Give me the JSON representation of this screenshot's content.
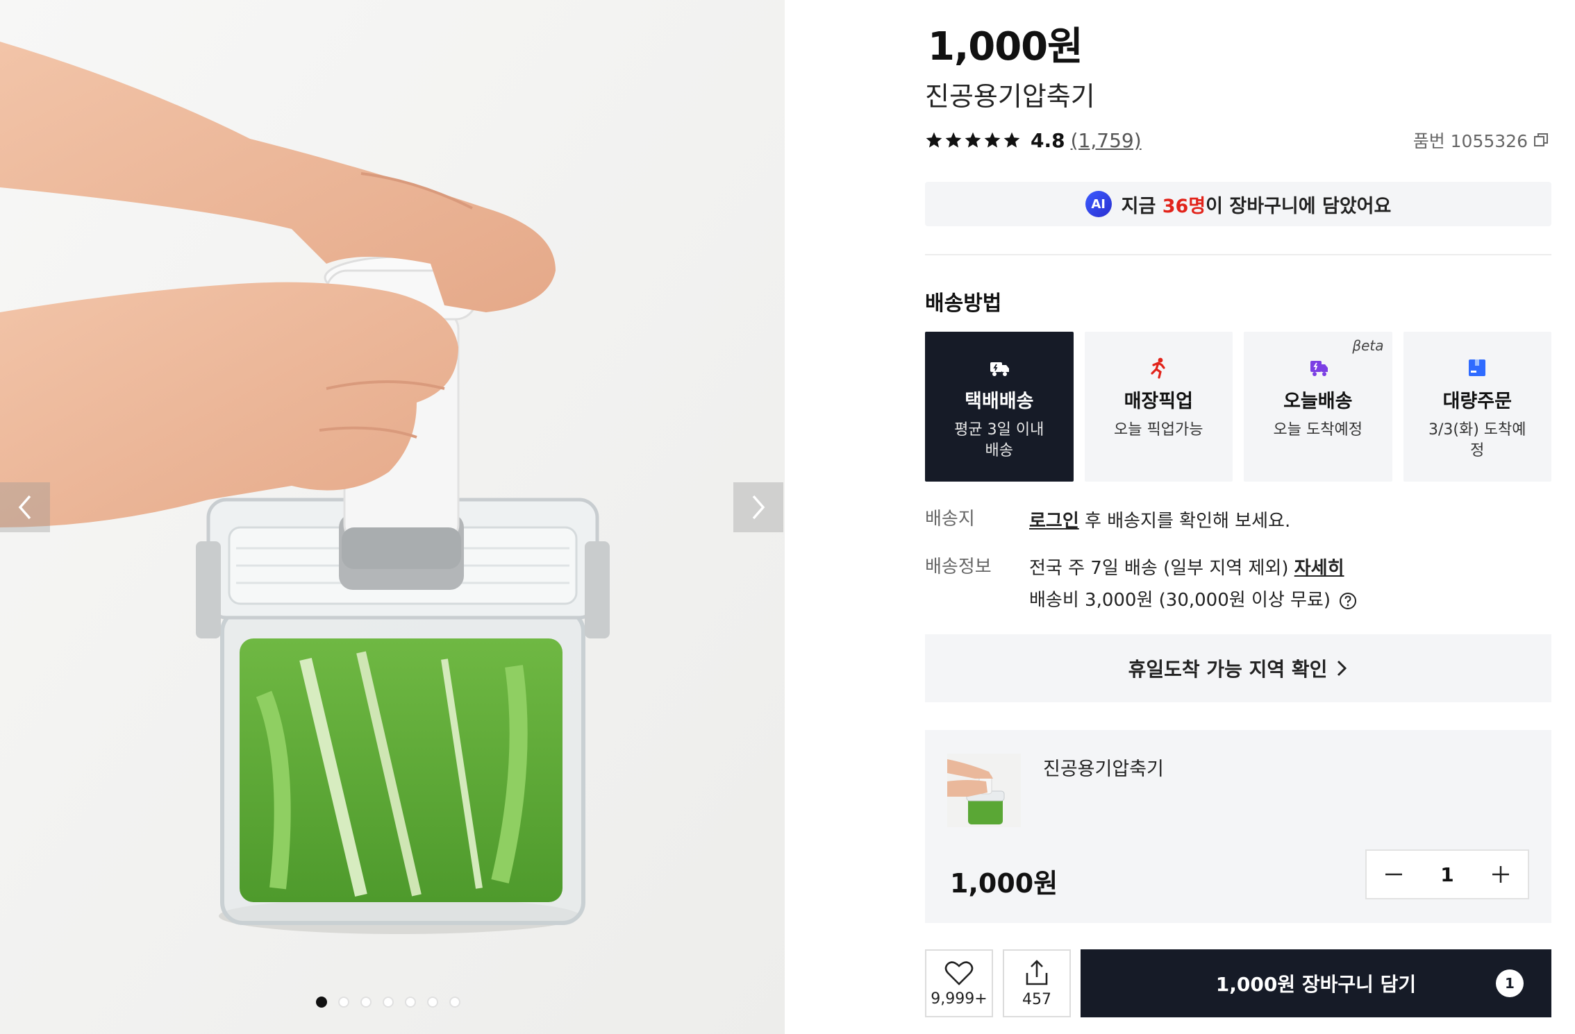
{
  "gallery": {
    "image_alt": "진공용기압축기",
    "dot_count": 7,
    "active_dot": 0
  },
  "product": {
    "price": "1,000원",
    "title": "진공용기압축기",
    "rating_value": "4.8",
    "rating_count": "(1,759)",
    "stars": 5,
    "sku": "품번 1055326"
  },
  "ai_banner": {
    "badge": "AI",
    "prefix": "지금 ",
    "highlight": "36명",
    "suffix": "이 장바구니에 담았어요"
  },
  "delivery": {
    "section_title": "배송방법",
    "options": [
      {
        "title": "택배배송",
        "sub": "평균 3일 이내 배송",
        "icon": "truck-icon",
        "selected": true,
        "beta": ""
      },
      {
        "title": "매장픽업",
        "sub": "오늘 픽업가능",
        "icon": "running-person-icon",
        "selected": false,
        "beta": ""
      },
      {
        "title": "오늘배송",
        "sub": "오늘 도착예정",
        "icon": "fast-delivery-icon",
        "selected": false,
        "beta": "βeta"
      },
      {
        "title": "대량주문",
        "sub": "3/3(화) 도착예정",
        "icon": "box-icon",
        "selected": false,
        "beta": ""
      }
    ],
    "address_label": "배송지",
    "address_link": "로그인",
    "address_text": " 후 배송지를 확인해 보세요.",
    "info_label": "배송정보",
    "info_line1": "전국 주 7일 배송 (일부 지역 제외) ",
    "info_link": "자세히",
    "info_line2": "배송비 3,000원 (30,000원 이상 무료)",
    "holiday_button": "휴일도착 가능 지역 확인"
  },
  "selected_option": {
    "name": "진공용기압축기",
    "price": "1,000원",
    "quantity": "1"
  },
  "actions": {
    "wishlist_count": "9,999+",
    "share_count": "457",
    "cart_label": "1,000원 장바구니 담기",
    "cart_badge": "1"
  },
  "colors": {
    "dark": "#161b27",
    "accent_red": "#e2231a",
    "pickup_red": "#e2231a",
    "today_purple": "#7b3fe4",
    "bulk_blue": "#2f6bff",
    "panel_bg": "#f4f5f7"
  }
}
